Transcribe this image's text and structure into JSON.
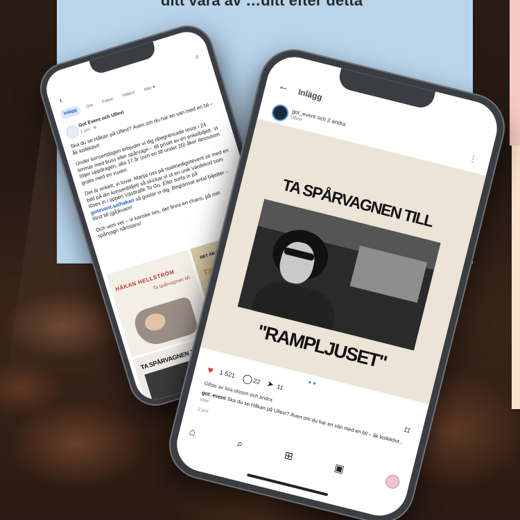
{
  "top_text": "ditt vara av …ditt efter detta",
  "phone_left": {
    "tabs": [
      "Inlägg",
      "Om",
      "Foton",
      "Videor",
      "Mer ▾"
    ],
    "post": {
      "author": "Got Event och Ullevi",
      "time": "2 juni · ⊕",
      "paragraphs": [
        "Ska du se Håkan på Ullevi? Även om du har en vän med en bil – åk kollektivt!",
        "Under konsertdagen erbjuder vi dig obegränsade resor i 24 timmar med buss eller spårvagn – till priset av en enkelbiljett. Vi följer uppdragen, alla 17 år (och en till under 20) åker dessutom gratis med en vuxen.",
        "Det är enkelt, vi lovar. Marija oss på mailinedigotevent.se med en bild på din konsertbiljett så skickar vi ut en unik värdekod som löses in i appen Västtrafik To Go. Eller surfa in på",
        "Och vem vet – vi kanske ses, det finns en chans, på min spårvagn nånstans!"
      ],
      "link": "gotevent.se/hakan",
      "link_suffix": " så guidar vi dig. Begränsat antal biljetter – först till (gå)kvarn!"
    },
    "grid": {
      "left_title": "HÅKAN HELLSTRÖM",
      "signature": "Ta spårvagnen till...",
      "right_title": "DET ÄR DIG JAG ÄLSKAR",
      "right_big": "TA VAGNEN",
      "bottom_title": "TA SPÅRVAGNEN TILL"
    }
  },
  "phone_right": {
    "header_title": "Inlägg",
    "user_name": "got_event och 2 andra",
    "user_sub": "Ullevi",
    "post_line1": "TA SPÅRVAGNEN TILL",
    "post_line2": "\"RAMPLJUSET\"",
    "likes_count": "1 521",
    "comments_count": "22",
    "shares_count": "11",
    "liked_by": "Gillas av lisa.olsson och andra",
    "caption_user": "got_event",
    "caption_text": " Ska du se Håkan på Ullevi? Även om du har en vän med en bil – åk kollektivt...",
    "caption_more": " mer",
    "date": "2 juni"
  }
}
